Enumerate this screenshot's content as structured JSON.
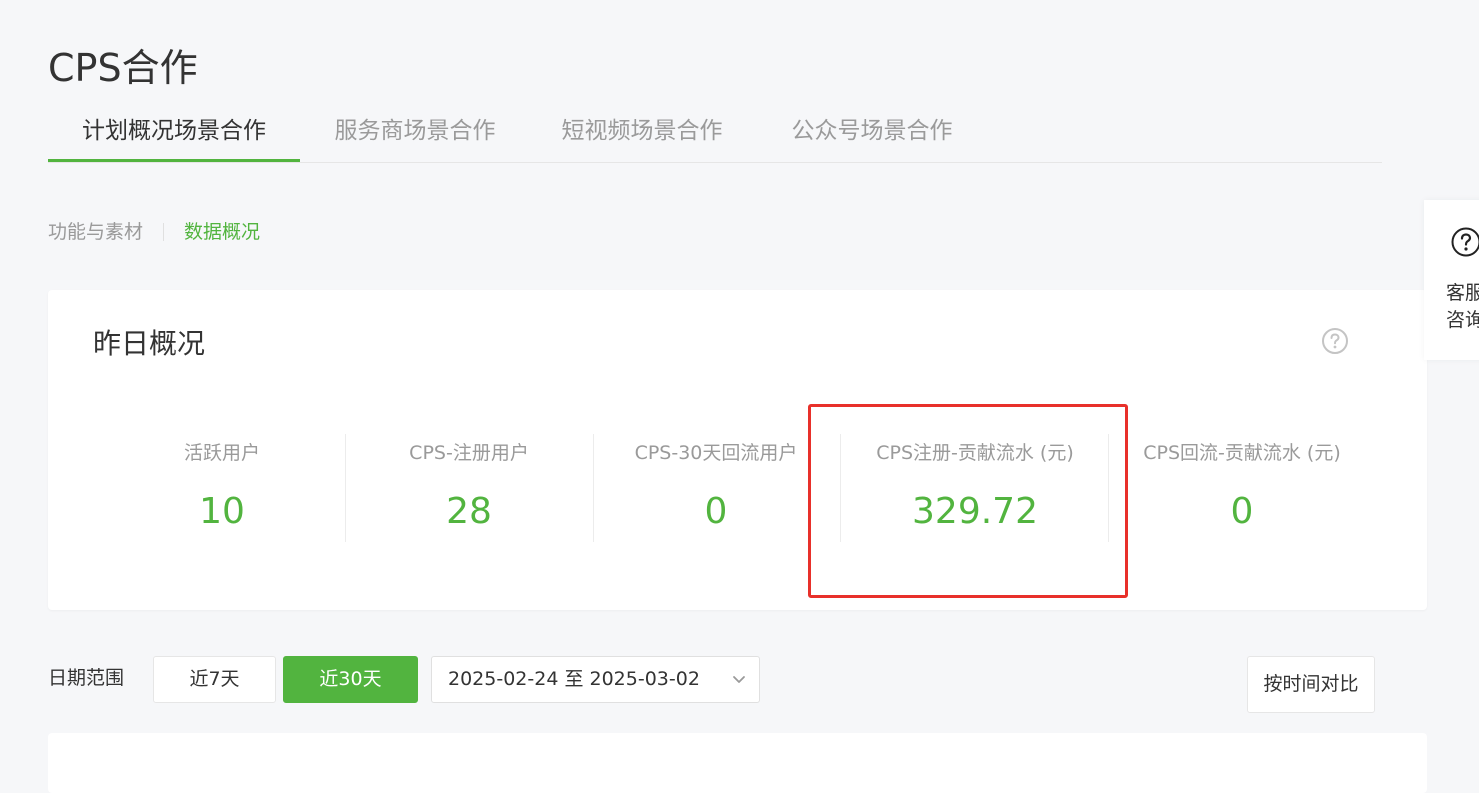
{
  "page": {
    "title": "CPS合作"
  },
  "tabs": [
    {
      "label": "计划概况场景合作",
      "active": true
    },
    {
      "label": "服务商场景合作",
      "active": false
    },
    {
      "label": "短视频场景合作",
      "active": false
    },
    {
      "label": "公众号场景合作",
      "active": false
    }
  ],
  "subnav": [
    {
      "label": "功能与素材",
      "active": false
    },
    {
      "label": "数据概况",
      "active": true
    }
  ],
  "overview": {
    "title": "昨日概况",
    "help_icon": "question-circle-icon",
    "stats": [
      {
        "label": "活跃用户",
        "value": "10"
      },
      {
        "label": "CPS-注册用户",
        "value": "28"
      },
      {
        "label": "CPS-30天回流用户",
        "value": "0"
      },
      {
        "label": "CPS注册-贡献流水 (元)",
        "value": "329.72"
      },
      {
        "label": "CPS回流-贡献流水 (元)",
        "value": "0"
      }
    ]
  },
  "filters": {
    "date_label": "日期范围",
    "range_7": "近7天",
    "range_30": "近30天",
    "selected_range": "近30天",
    "date_value": "2025-02-24 至 2025-03-02",
    "compare_label": "按时间对比"
  },
  "side": {
    "label": "客服咨询",
    "icon": "question-circle-icon"
  },
  "colors": {
    "accent": "#52b43f",
    "highlight": "#e8302a"
  }
}
